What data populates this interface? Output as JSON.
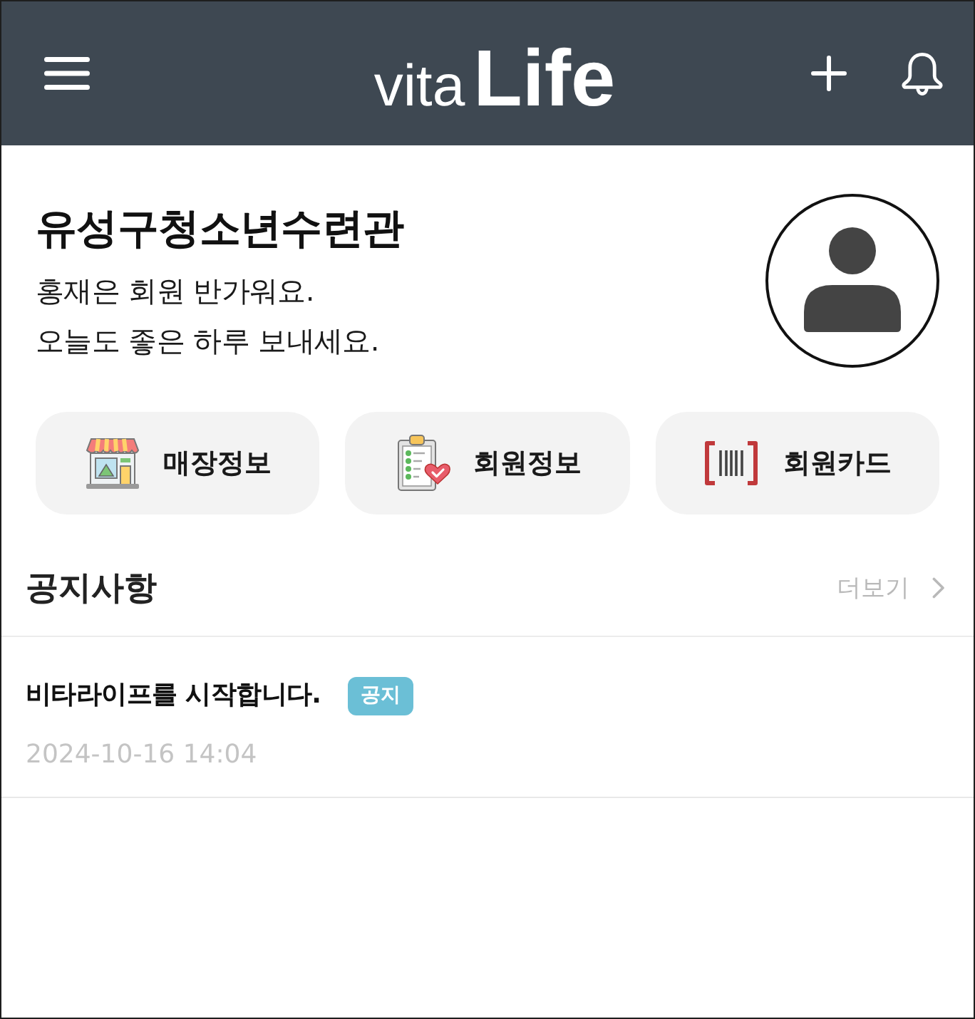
{
  "header": {
    "logo": "vita**Life**"
  },
  "profile": {
    "title": "유성구청소년수련관",
    "greeting": [
      "홍재은 회원 반가워요.",
      "오늘도 좋은 하루 보내세요."
    ]
  },
  "shortcuts": [
    {
      "kind": "store",
      "label": "매장정보"
    },
    {
      "kind": "member",
      "label": "회원정보"
    },
    {
      "kind": "card",
      "label": "회원카드"
    }
  ],
  "notices": {
    "title": "공지사항",
    "more": "더보기",
    "items": [
      {
        "title": "비타라이프를 시작합니다.",
        "tag": "공지",
        "date": "2024-10-16 14:04"
      }
    ]
  }
}
